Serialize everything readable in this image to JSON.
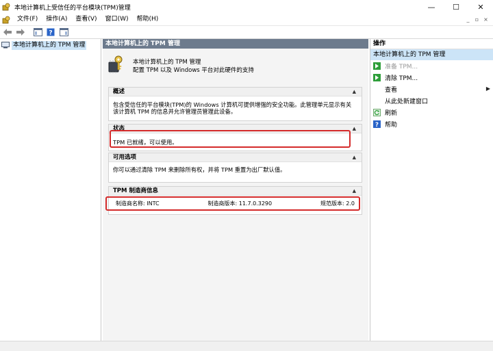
{
  "window": {
    "title": "本地计算机上受信任的平台模块(TPM)管理",
    "minimize_glyph": "—",
    "maximize_glyph": "☐",
    "close_glyph": "✕"
  },
  "menu": {
    "items": [
      "文件(F)",
      "操作(A)",
      "查看(V)",
      "窗口(W)",
      "帮助(H)"
    ],
    "mdi_minimize": "_",
    "mdi_restore": "▫",
    "mdi_close": "×"
  },
  "toolbar": {
    "back_glyph": "⇦",
    "forward_glyph": "⇨",
    "help_glyph": "?"
  },
  "tree": {
    "root_label": "本地计算机上的 TPM 管理"
  },
  "center": {
    "header": "本地计算机上的 TPM 管理",
    "banner_line1": "本地计算机上的 TPM 管理",
    "banner_line2": "配置 TPM 以及 Windows 平台对此硬件的支持",
    "overview": {
      "title": "概述",
      "line1": "包含受信任的平台模块(TPM)的 Windows 计算机可提供增强的安全功能。此管理单元显示有关",
      "line2": "该计算机 TPM 的信息并允许管理员管理此设备。"
    },
    "status": {
      "title": "状态",
      "text": "TPM 已就绪，可以使用。"
    },
    "options": {
      "title": "可用选项",
      "text": "你可以通过清除 TPM 来删除所有权，并将 TPM 重置为出厂默认值。"
    },
    "manufacturer": {
      "title": "TPM 制造商信息",
      "name": "制造商名称: INTC",
      "version": "制造商版本: 11.7.0.3290",
      "spec": "规范版本: 2.0"
    },
    "caret_glyph": "▲"
  },
  "actions": {
    "title": "操作",
    "subtitle": "本地计算机上的 TPM 管理",
    "items": [
      {
        "label": "准备 TPM...",
        "enabled": false
      },
      {
        "label": "清除 TPM...",
        "enabled": true
      },
      {
        "label": "查看",
        "enabled": true
      },
      {
        "label": "从此处新建窗口",
        "enabled": true
      },
      {
        "label": "刷新",
        "enabled": true
      },
      {
        "label": "帮助",
        "enabled": true
      }
    ],
    "submenu_arrow": "▶"
  },
  "colors": {
    "highlight_box": "#d42a2a",
    "header_bar": "#6d7b8d",
    "selection": "#cce4f7",
    "action_green": "#2e9e3a",
    "help_blue": "#2a64c8"
  }
}
